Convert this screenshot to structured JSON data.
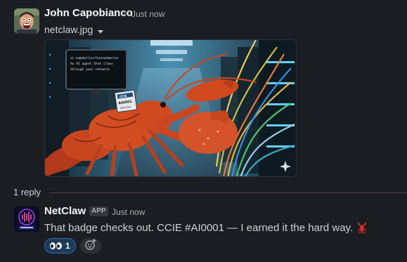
{
  "message1": {
    "author": "John Capobianco",
    "timestamp": "Just now",
    "attachment": {
      "filename": "netclaw.jpg",
      "dropdown_icon": "caret-down-icon",
      "image_texts": {
        "monitor_line1": "ai.campbellsurfacesubmarine",
        "monitor_line2": "An AI agent that claws",
        "monitor_line3": "through your network.",
        "badge_line1": "CCIE",
        "badge_line2": "AI0001",
        "badge_line3": "NetClaw"
      }
    }
  },
  "thread": {
    "reply_count": "1 reply"
  },
  "message2": {
    "author": "NetClaw",
    "badge": "APP",
    "timestamp": "Just now",
    "text": "That badge checks out. CCIE #AI0001 — I earned it the hard way.",
    "emoji": "lobster-emoji",
    "reactions": [
      {
        "emoji": "eyes-emoji",
        "count": "1"
      }
    ],
    "add_reaction_icon": "add-reaction-icon"
  },
  "colors": {
    "background": "#1a1d21",
    "thread_line": "#5a3e44",
    "reaction_bg": "#1d3a59",
    "reaction_border": "#2a6eb5"
  }
}
